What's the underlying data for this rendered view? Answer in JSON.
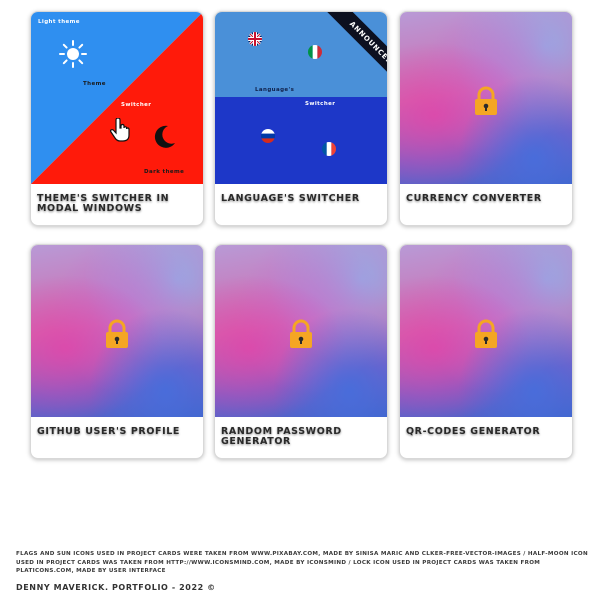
{
  "colors": {
    "theme_light": "#2f8ff0",
    "theme_dark": "#ff1a0a",
    "lang_top": "#4a90d8",
    "lang_bottom": "#1d37c8",
    "lock": "#f5a623",
    "ribbon": "#0c1020"
  },
  "cards": [
    {
      "title": "Theme's switcher in modal windows",
      "icons": [
        "sun-icon",
        "moon-icon",
        "pointer-hand-icon"
      ],
      "labels": {
        "light": "Light theme",
        "theme": "Theme",
        "switcher": "Switcher",
        "dark": "Dark theme"
      }
    },
    {
      "title": "Language's switcher",
      "ribbon": "Announced",
      "icons": [
        "uk-flag-icon",
        "italy-flag-icon",
        "russia-flag-icon",
        "france-flag-icon"
      ],
      "labels": {
        "language": "Language's",
        "switcher": "Switcher"
      }
    },
    {
      "title": "Currency converter",
      "icons": [
        "lock-icon"
      ]
    },
    {
      "title": "Github user's profile",
      "icons": [
        "lock-icon"
      ]
    },
    {
      "title": "Random password generator",
      "icons": [
        "lock-icon"
      ]
    },
    {
      "title": "QR-codes generator",
      "icons": [
        "lock-icon"
      ]
    }
  ],
  "footer": {
    "credits": "Flags and sun icons used in project cards were taken from www.pixabay.com, made by Sinisa Maric and Clker-Free-Vector-Images / Half-moon icon used in project cards was taken from http://www.iconsmind.com, made by iconsmind / Lock icon used in project cards was taken from platicons.com, made by User Interface",
    "copyright": "Denny Maverick. Portfolio - 2022 ©"
  }
}
